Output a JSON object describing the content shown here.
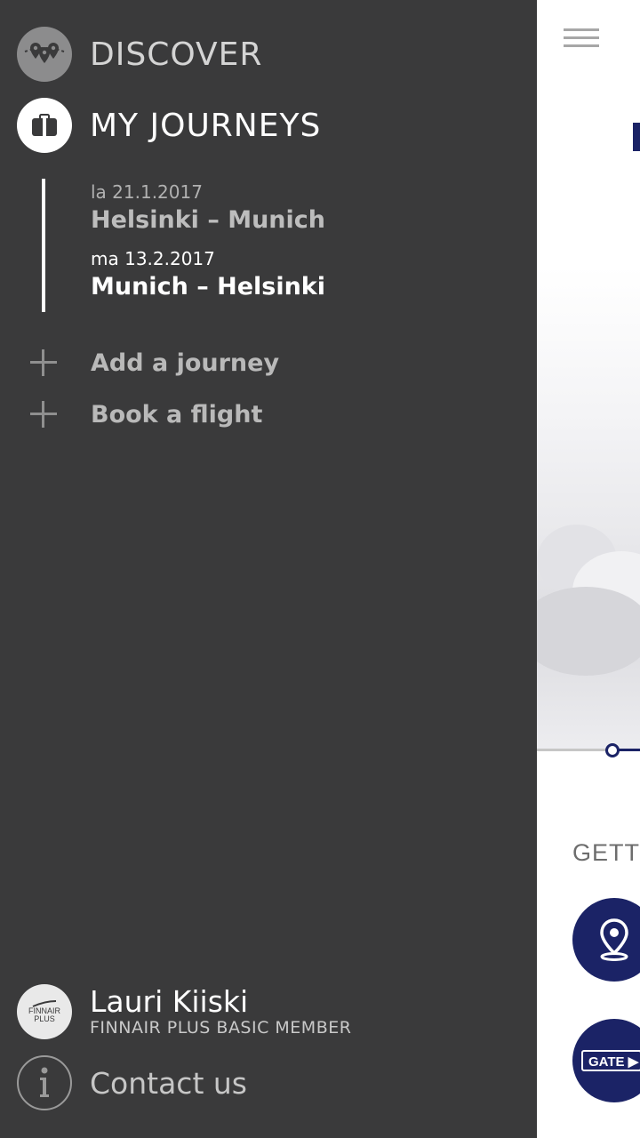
{
  "drawer": {
    "nav": {
      "discover": {
        "label": "DISCOVER",
        "icon": "map-pins-icon"
      },
      "my_journeys": {
        "label": "MY JOURNEYS",
        "icon": "suitcase-icon"
      }
    },
    "journeys": [
      {
        "date": "la 21.1.2017",
        "route": "Helsinki – Munich"
      },
      {
        "date": "ma 13.2.2017",
        "route": "Munich – Helsinki"
      }
    ],
    "actions": {
      "add_journey": "Add a journey",
      "book_flight": "Book a flight"
    },
    "profile": {
      "name": "Lauri Kiiski",
      "tier": "FINNAIR PLUS BASIC MEMBER",
      "logo_line1": "FINNAIR",
      "logo_line2": "PLUS"
    },
    "contact": {
      "label": "Contact us",
      "icon": "info-icon"
    }
  },
  "background_app": {
    "section_label": "GETTI",
    "gate_label": "GATE",
    "colors": {
      "navy": "#1b2366",
      "drawer": "#3a3a3b"
    }
  }
}
